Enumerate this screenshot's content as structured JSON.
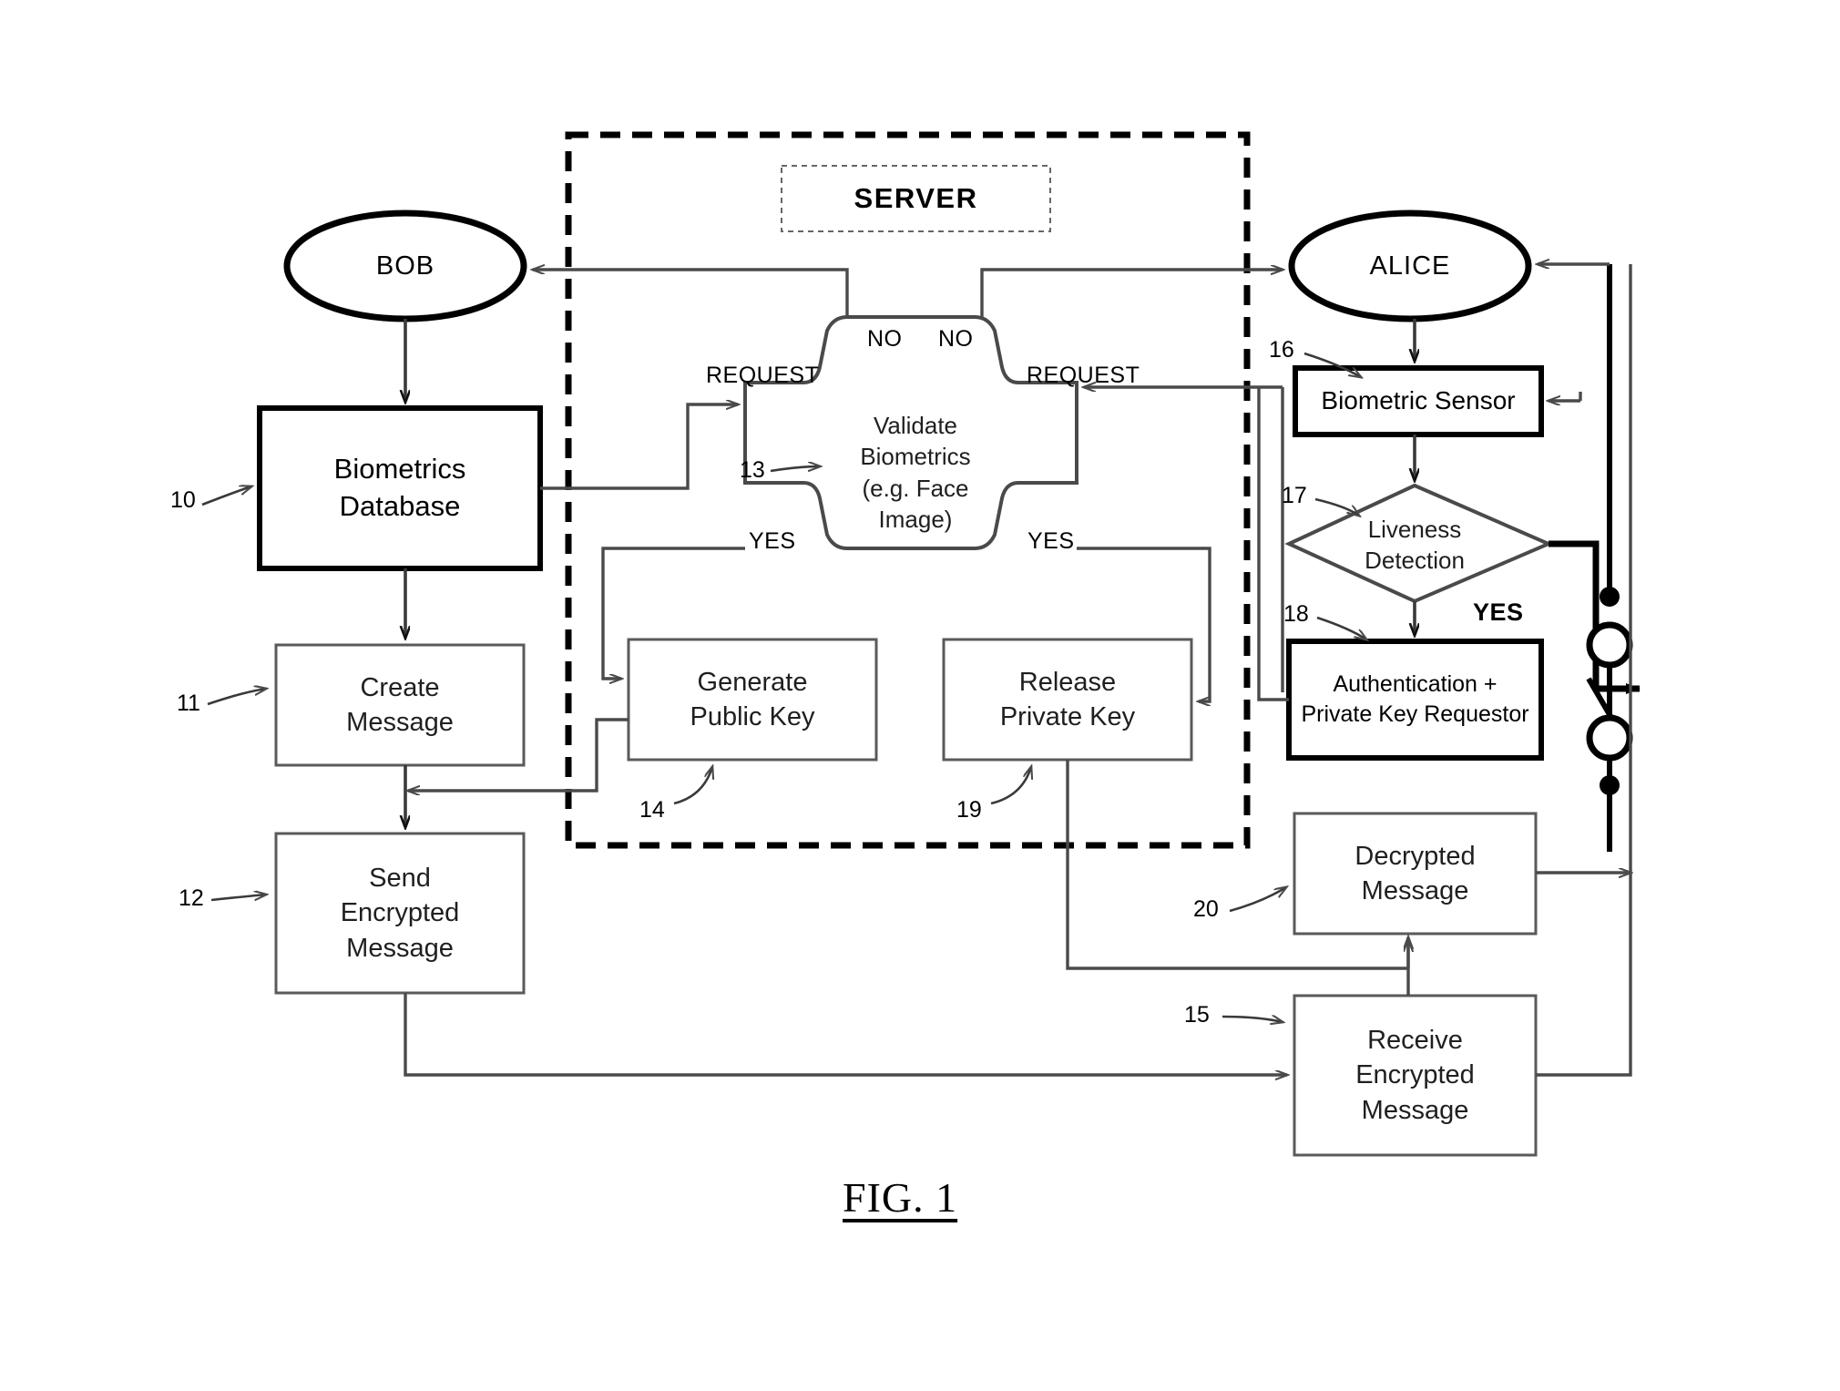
{
  "figure": {
    "caption": "FIG. 1",
    "server_boundary_label": "SERVER"
  },
  "actors": {
    "bob": "BOB",
    "alice": "ALICE"
  },
  "nodes": {
    "biometrics_database": {
      "label": "Biometrics\nDatabase",
      "ref": "10"
    },
    "create_message": {
      "label": "Create\nMessage",
      "ref": "11"
    },
    "send_encrypted_message": {
      "label": "Send\nEncrypted\nMessage",
      "ref": "12"
    },
    "validate_biometrics": {
      "label": "Validate\nBiometrics\n(e.g. Face\nImage)",
      "ref": "13"
    },
    "generate_public_key": {
      "label": "Generate\nPublic Key",
      "ref": "14"
    },
    "release_private_key": {
      "label": "Release\nPrivate Key",
      "ref": "19"
    },
    "biometric_sensor": {
      "label": "Biometric Sensor",
      "ref": "16"
    },
    "liveness_detection": {
      "label": "Liveness\nDetection",
      "ref": "17"
    },
    "authentication_requestor": {
      "label": "Authentication +\nPrivate Key Requestor",
      "ref": "18"
    },
    "receive_encrypted_message": {
      "label": "Receive\nEncrypted\nMessage",
      "ref": "15"
    },
    "decrypted_message": {
      "label": "Decrypted\nMessage",
      "ref": "20"
    }
  },
  "edge_labels": {
    "request_left": "REQUEST",
    "request_right": "REQUEST",
    "no_left": "NO",
    "no_right": "NO",
    "yes_left": "YES",
    "yes_right": "YES",
    "yes_liveness": "YES"
  },
  "colors": {
    "stroke_heavy": "#000000",
    "stroke_light": "#595959",
    "background": "#ffffff"
  }
}
